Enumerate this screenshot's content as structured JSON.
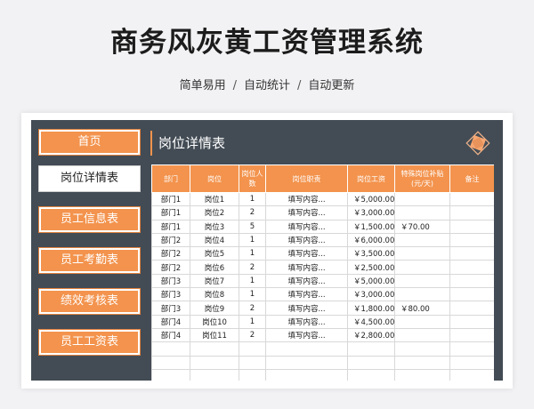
{
  "page": {
    "title": "商务风灰黄工资管理系统",
    "subtitle_parts": [
      "简单易用",
      "自动统计",
      "自动更新"
    ],
    "separator": "/"
  },
  "colors": {
    "accent": "#f3934d",
    "panel": "#434c55",
    "background": "#f2f2f4"
  },
  "sidebar": {
    "items": [
      {
        "label": "首页",
        "active": false
      },
      {
        "label": "岗位详情表",
        "active": true
      },
      {
        "label": "员工信息表",
        "active": false
      },
      {
        "label": "员工考勤表",
        "active": false
      },
      {
        "label": "绩效考核表",
        "active": false
      },
      {
        "label": "员工工资表",
        "active": false
      }
    ]
  },
  "header": {
    "title": "岗位详情表",
    "deco_icon": "diamond-logo-icon"
  },
  "table": {
    "columns": [
      "部门",
      "岗位",
      "岗位人数",
      "岗位职责",
      "岗位工资",
      "特殊岗位补贴(元/天)",
      "备注"
    ],
    "rows": [
      [
        "部门1",
        "岗位1",
        "1",
        "填写内容...",
        "￥5,000.00",
        "",
        ""
      ],
      [
        "部门1",
        "岗位2",
        "2",
        "填写内容...",
        "￥3,000.00",
        "",
        ""
      ],
      [
        "部门1",
        "岗位3",
        "5",
        "填写内容...",
        "￥1,500.00",
        "￥70.00",
        ""
      ],
      [
        "部门2",
        "岗位4",
        "1",
        "填写内容...",
        "￥6,000.00",
        "",
        ""
      ],
      [
        "部门2",
        "岗位5",
        "1",
        "填写内容...",
        "￥3,500.00",
        "",
        ""
      ],
      [
        "部门2",
        "岗位6",
        "2",
        "填写内容...",
        "￥2,500.00",
        "",
        ""
      ],
      [
        "部门3",
        "岗位7",
        "1",
        "填写内容...",
        "￥5,000.00",
        "",
        ""
      ],
      [
        "部门3",
        "岗位8",
        "1",
        "填写内容...",
        "￥3,000.00",
        "",
        ""
      ],
      [
        "部门3",
        "岗位9",
        "2",
        "填写内容...",
        "￥1,800.00",
        "￥80.00",
        ""
      ],
      [
        "部门4",
        "岗位10",
        "1",
        "填写内容...",
        "￥4,500.00",
        "",
        ""
      ],
      [
        "部门4",
        "岗位11",
        "2",
        "填写内容...",
        "￥2,800.00",
        "",
        ""
      ],
      [
        "",
        "",
        "",
        "",
        "",
        "",
        ""
      ],
      [
        "",
        "",
        "",
        "",
        "",
        "",
        ""
      ],
      [
        "",
        "",
        "",
        "",
        "",
        "",
        ""
      ]
    ]
  }
}
